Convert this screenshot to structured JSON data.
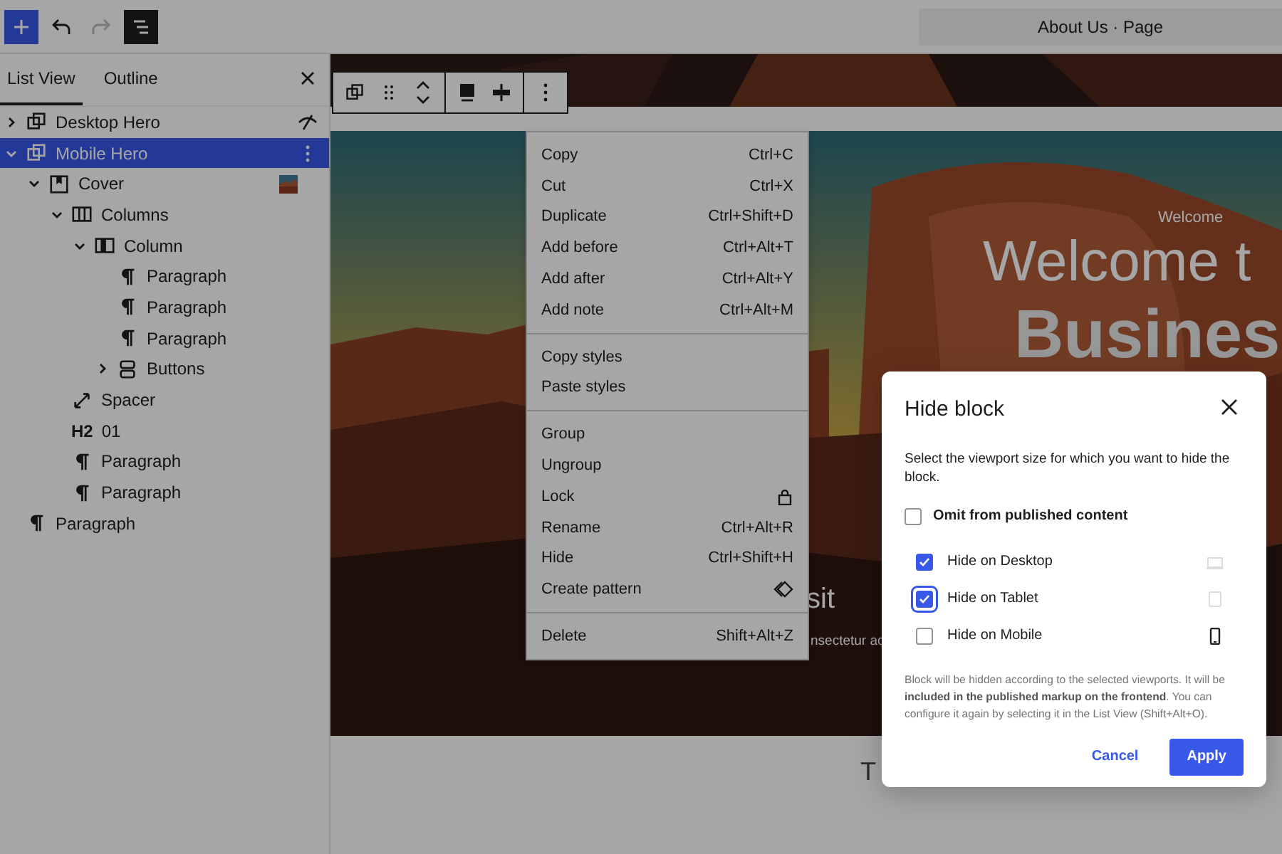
{
  "topbar": {
    "document_title": "About Us · Page",
    "redo_disabled": true,
    "list_view_on": true
  },
  "sidebar": {
    "tabs": [
      {
        "label": "List View",
        "selected": true
      },
      {
        "label": "Outline",
        "selected": false
      }
    ],
    "tree": [
      {
        "label": "Desktop Hero",
        "kind": "group",
        "expanded": false,
        "selected": false,
        "hidden": true
      },
      {
        "label": "Mobile Hero",
        "kind": "group",
        "expanded": true,
        "selected": true,
        "children": [
          {
            "label": "Cover",
            "kind": "cover",
            "expanded": true,
            "selected": false,
            "children": [
              {
                "label": "Columns",
                "kind": "columns",
                "expanded": true,
                "selected": false,
                "children": [
                  {
                    "label": "Column",
                    "kind": "column",
                    "expanded": true,
                    "selected": false,
                    "children": [
                      {
                        "label": "Paragraph",
                        "kind": "paragraph",
                        "selected": false
                      },
                      {
                        "label": "Paragraph",
                        "kind": "paragraph",
                        "selected": false
                      },
                      {
                        "label": "Paragraph",
                        "kind": "paragraph",
                        "selected": false
                      },
                      {
                        "label": "Buttons",
                        "kind": "buttons",
                        "expanded": false,
                        "selected": false
                      }
                    ]
                  }
                ]
              },
              {
                "label": "Spacer",
                "kind": "spacer",
                "selected": false
              },
              {
                "label": "01",
                "kind": "heading",
                "icon_label": "H2",
                "selected": false
              },
              {
                "label": "Paragraph",
                "kind": "paragraph",
                "selected": false
              },
              {
                "label": "Paragraph",
                "kind": "paragraph",
                "selected": false
              }
            ]
          }
        ]
      },
      {
        "label": "Paragraph",
        "kind": "paragraph",
        "selected": false
      }
    ]
  },
  "canvas": {
    "small_heading": "Welcome",
    "heading": "Welcome t",
    "big_heading": "Busines",
    "partial_text": "sit",
    "partial_line": "nsectetur ac",
    "below_text": "T"
  },
  "context_menu": {
    "groups": [
      [
        {
          "label": "Copy",
          "shortcut": "Ctrl+C"
        },
        {
          "label": "Cut",
          "shortcut": "Ctrl+X"
        },
        {
          "label": "Duplicate",
          "shortcut": "Ctrl+Shift+D"
        },
        {
          "label": "Add before",
          "shortcut": "Ctrl+Alt+T"
        },
        {
          "label": "Add after",
          "shortcut": "Ctrl+Alt+Y"
        },
        {
          "label": "Add note",
          "shortcut": "Ctrl+Alt+M"
        }
      ],
      [
        {
          "label": "Copy styles"
        },
        {
          "label": "Paste styles"
        }
      ],
      [
        {
          "label": "Group"
        },
        {
          "label": "Ungroup"
        },
        {
          "label": "Lock",
          "kind": "lock"
        },
        {
          "label": "Rename",
          "shortcut": "Ctrl+Alt+R"
        },
        {
          "label": "Hide",
          "shortcut": "Ctrl+Shift+H"
        },
        {
          "label": "Create pattern",
          "kind": "pattern"
        }
      ],
      [
        {
          "label": "Delete",
          "shortcut": "Shift+Alt+Z"
        }
      ]
    ]
  },
  "dialog": {
    "title": "Hide block",
    "description": "Select the viewport size for which you want to hide the block.",
    "omit": {
      "label": "Omit from published content",
      "checked": false
    },
    "options": [
      {
        "label": "Hide on Desktop",
        "kind": "desktop",
        "checked": true,
        "focused": false
      },
      {
        "label": "Hide on Tablet",
        "kind": "tablet",
        "checked": true,
        "focused": true
      },
      {
        "label": "Hide on Mobile",
        "kind": "mobile",
        "checked": false,
        "focused": false
      }
    ],
    "note": "Block will be hidden according to the selected viewports. It will be **included in the published markup on the frontend**. You can configure it again by selecting it in the List View (Shift+Alt+O).",
    "buttons": [
      {
        "label": "Cancel",
        "kind": "secondary"
      },
      {
        "label": "Apply",
        "kind": "primary"
      }
    ]
  }
}
